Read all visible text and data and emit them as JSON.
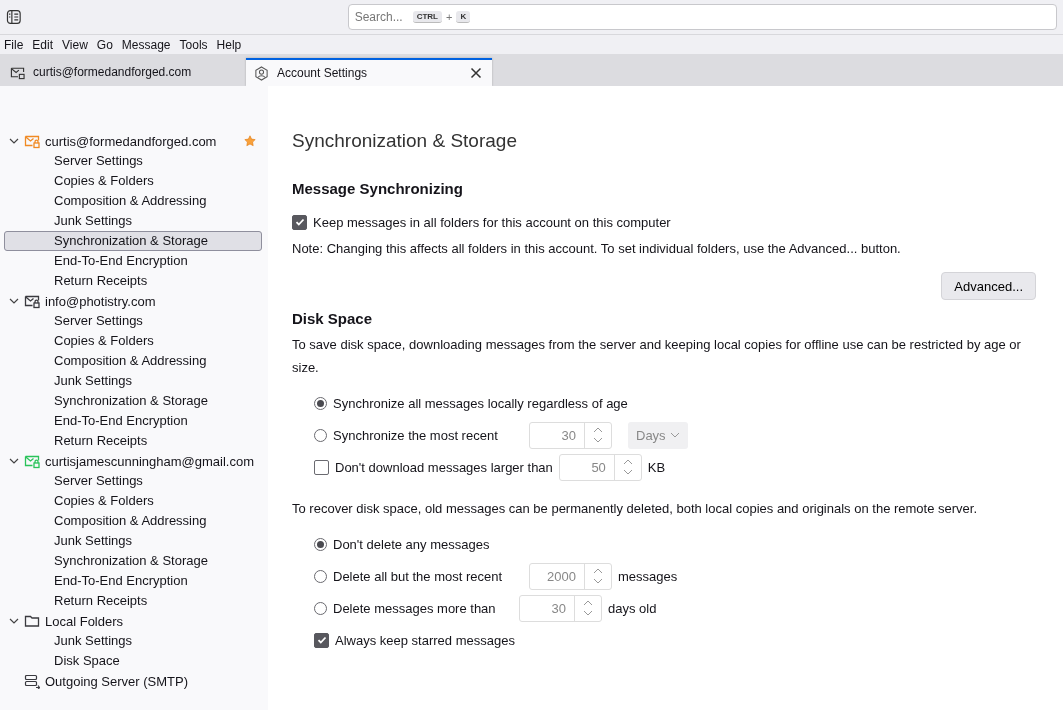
{
  "toolbar": {
    "search_placeholder": "Search...",
    "shortcut": [
      "CTRL",
      "+",
      "K"
    ]
  },
  "menu": [
    "File",
    "Edit",
    "View",
    "Go",
    "Message",
    "Tools",
    "Help"
  ],
  "tabs": [
    {
      "label": "curtis@formedandforged.com",
      "kind": "mail",
      "selected": false
    },
    {
      "label": "Account Settings",
      "kind": "settings",
      "selected": true
    }
  ],
  "sidebar": {
    "accounts": [
      {
        "label": "curtis@formedandforged.com",
        "kind": "mail",
        "color": "#f08a24",
        "expanded": true,
        "default": true,
        "children": [
          {
            "label": "Server Settings",
            "selected": false
          },
          {
            "label": "Copies & Folders",
            "selected": false
          },
          {
            "label": "Composition & Addressing",
            "selected": false
          },
          {
            "label": "Junk Settings",
            "selected": false
          },
          {
            "label": "Synchronization & Storage",
            "selected": true
          },
          {
            "label": "End-To-End Encryption",
            "selected": false
          },
          {
            "label": "Return Receipts",
            "selected": false
          }
        ]
      },
      {
        "label": "info@photistry.com",
        "kind": "mail",
        "color": "#3a3a3f",
        "expanded": true,
        "default": false,
        "children": [
          {
            "label": "Server Settings",
            "selected": false
          },
          {
            "label": "Copies & Folders",
            "selected": false
          },
          {
            "label": "Composition & Addressing",
            "selected": false
          },
          {
            "label": "Junk Settings",
            "selected": false
          },
          {
            "label": "Synchronization & Storage",
            "selected": false
          },
          {
            "label": "End-To-End Encryption",
            "selected": false
          },
          {
            "label": "Return Receipts",
            "selected": false
          }
        ]
      },
      {
        "label": "curtisjamescunningham@gmail.com",
        "kind": "mail",
        "color": "#2ac35a",
        "expanded": true,
        "default": false,
        "children": [
          {
            "label": "Server Settings",
            "selected": false
          },
          {
            "label": "Copies & Folders",
            "selected": false
          },
          {
            "label": "Composition & Addressing",
            "selected": false
          },
          {
            "label": "Junk Settings",
            "selected": false
          },
          {
            "label": "Synchronization & Storage",
            "selected": false
          },
          {
            "label": "End-To-End Encryption",
            "selected": false
          },
          {
            "label": "Return Receipts",
            "selected": false
          }
        ]
      },
      {
        "label": "Local Folders",
        "kind": "folder",
        "color": "#3a3a3f",
        "expanded": true,
        "default": false,
        "children": [
          {
            "label": "Junk Settings",
            "selected": false
          },
          {
            "label": "Disk Space",
            "selected": false
          }
        ]
      },
      {
        "label": "Outgoing Server (SMTP)",
        "kind": "server",
        "color": "#3a3a3f"
      }
    ]
  },
  "page": {
    "title": "Synchronization & Storage",
    "sync": {
      "heading": "Message Synchronizing",
      "option": {
        "label": "Keep messages in all folders for this account on this computer",
        "checked": true
      },
      "note": "Note: Changing this affects all folders in this account. To set individual folders, use the Advanced... button.",
      "button": "Advanced..."
    },
    "disk": {
      "heading": "Disk Space",
      "intro": "To save disk space, downloading messages from the server and keeping local copies for offline use can be restricted by age or size.",
      "options": [
        {
          "kind": "radio",
          "label": "Synchronize all messages locally regardless of age",
          "selected": true
        },
        {
          "kind": "radio",
          "label": "Synchronize the most recent",
          "selected": false,
          "spinner": {
            "value": "30",
            "disabled": true
          },
          "select": {
            "value": "Days",
            "disabled": true
          }
        },
        {
          "kind": "checkbox",
          "label": "Don't download messages larger than",
          "checked": false,
          "spinner": {
            "value": "50",
            "disabled": true
          },
          "suffix": "KB"
        }
      ],
      "recover_intro": "To recover disk space, old messages can be permanently deleted, both local copies and originals on the remote server.",
      "recover_options": [
        {
          "kind": "radio",
          "label": "Don't delete any messages",
          "selected": true
        },
        {
          "kind": "radio",
          "label": "Delete all but the most recent",
          "selected": false,
          "spinner": {
            "value": "2000",
            "disabled": true
          },
          "suffix": "messages"
        },
        {
          "kind": "radio",
          "label": "Delete messages more than",
          "selected": false,
          "spinner": {
            "value": "30",
            "disabled": true
          },
          "suffix": "days old"
        },
        {
          "kind": "checkbox",
          "label": "Always keep starred messages",
          "checked": true
        }
      ]
    }
  }
}
